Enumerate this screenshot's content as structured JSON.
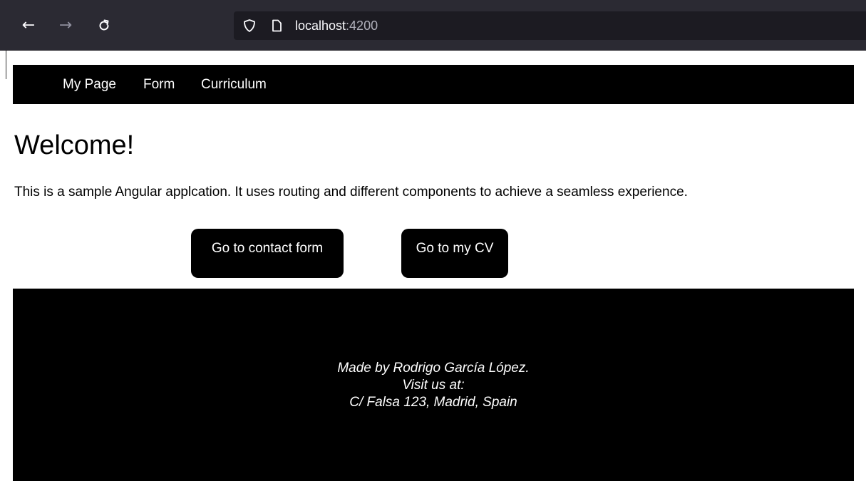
{
  "browser": {
    "back_icon": "arrow-left-icon",
    "forward_icon": "arrow-right-icon",
    "reload_icon": "reload-icon",
    "url_host": "localhost",
    "url_port": ":4200"
  },
  "navbar": {
    "items": [
      {
        "label": "My Page"
      },
      {
        "label": "Form"
      },
      {
        "label": "Curriculum"
      }
    ]
  },
  "main": {
    "title": "Welcome!",
    "description": "This is a sample Angular applcation. It uses routing and different components to achieve a seamless experience.",
    "buttons": {
      "contact_label": "Go to contact form",
      "cv_label": "Go to my CV"
    }
  },
  "footer": {
    "line1": "Made by Rodrigo García López.",
    "line2": "Visit us at:",
    "line3": "C/ Falsa 123, Madrid, Spain"
  },
  "colors": {
    "toolbar_bg": "#2b2a33",
    "url_bar_bg": "#1c1b22",
    "nav_bg": "#000000",
    "button_bg": "#000000",
    "footer_bg": "#000000"
  }
}
